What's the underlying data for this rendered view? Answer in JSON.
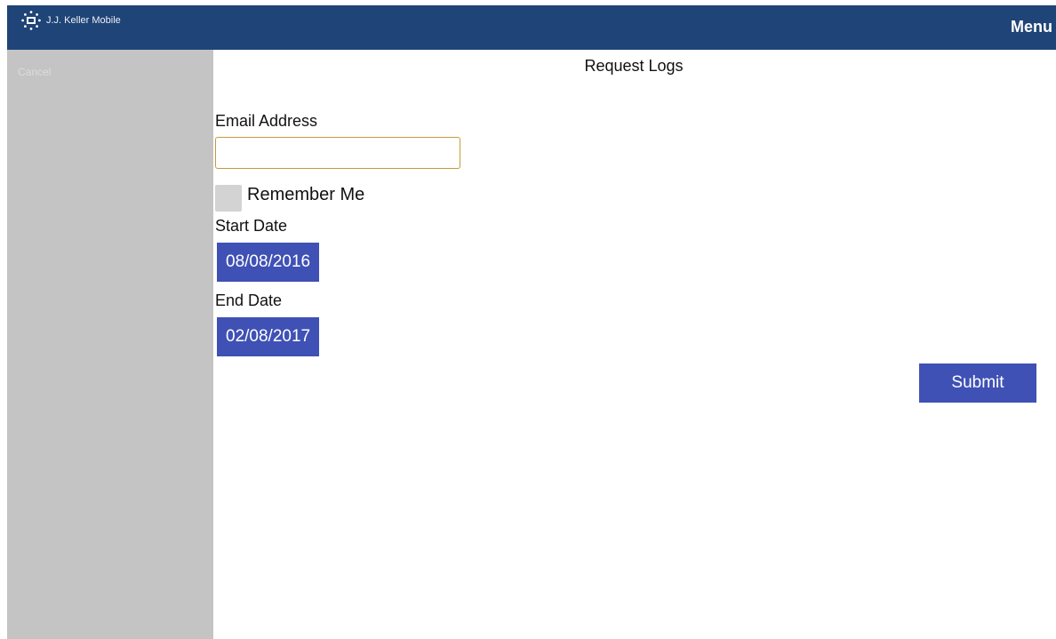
{
  "header": {
    "app_name": "J.J. Keller Mobile",
    "logo_icon": "jj-keller-logo-icon",
    "menu_label": "Menu"
  },
  "sidebar": {
    "item": "Cancel"
  },
  "main": {
    "title": "Request Logs",
    "email_label": "Email Address",
    "email_value": "",
    "remember_label": "Remember Me",
    "remember_checked": false,
    "start_date_label": "Start Date",
    "start_date_value": "08/08/2016",
    "end_date_label": "End Date",
    "end_date_value": "02/08/2017",
    "submit_label": "Submit"
  },
  "colors": {
    "header_bg": "#1f4477",
    "sidebar_bg": "#c4c4c4",
    "button_bg": "#3f51b5",
    "input_border": "#c59a3b"
  }
}
